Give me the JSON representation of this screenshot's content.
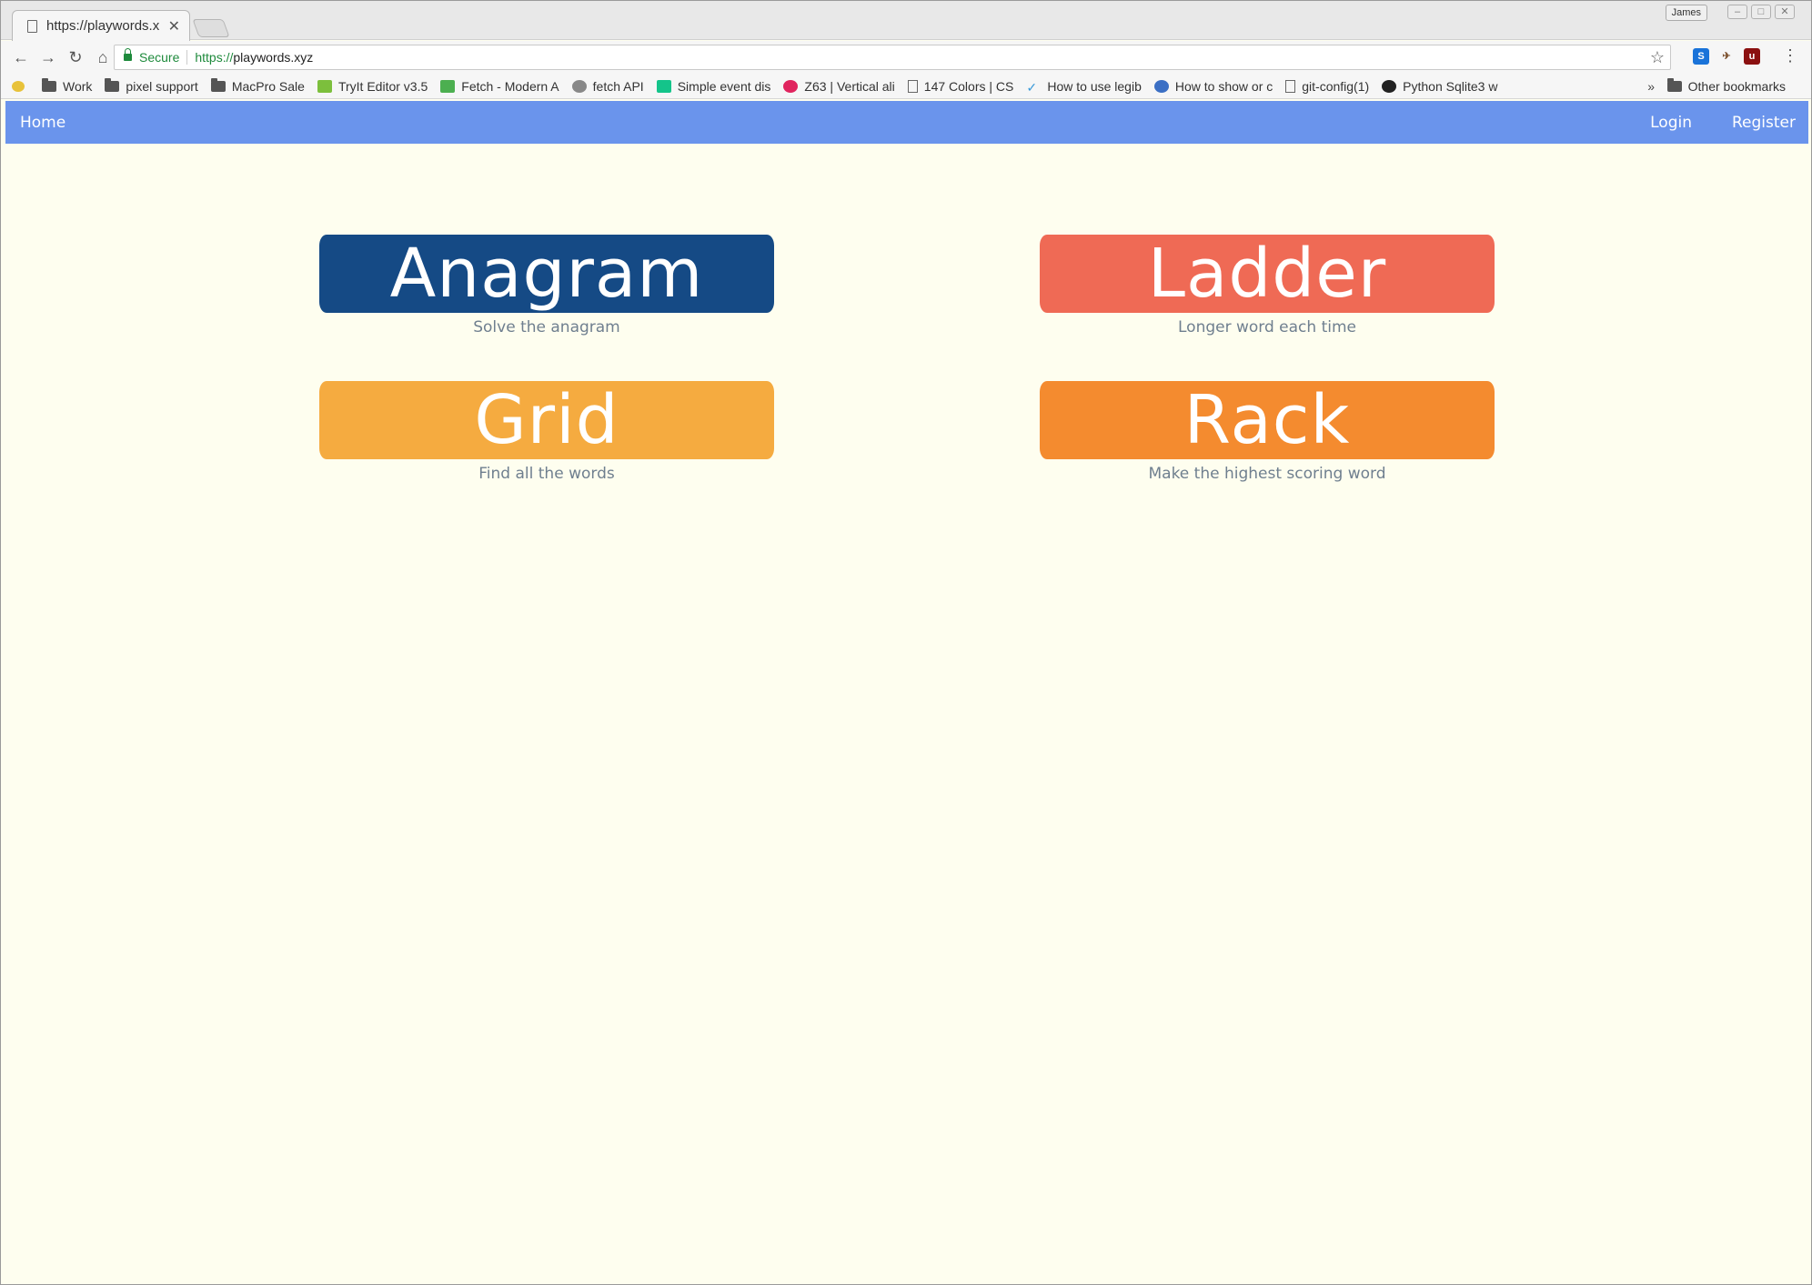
{
  "browser": {
    "tab_title": "https://playwords.x",
    "profile_name": "James",
    "security_label": "Secure",
    "url_scheme": "https://",
    "url_host": "playwords.xyz",
    "bookmarks": [
      "Work",
      "pixel support",
      "MacPro Sale",
      "TryIt Editor v3.5",
      "Fetch - Modern A",
      "fetch API",
      "Simple event dis",
      "Z63 | Vertical ali",
      "147 Colors | CS",
      "How to use legib",
      "How to show or c",
      "git-config(1)",
      "Python Sqlite3 w"
    ],
    "overflow_label": "»",
    "other_bookmarks": "Other bookmarks"
  },
  "navbar": {
    "home": "Home",
    "login": "Login",
    "register": "Register"
  },
  "games": [
    {
      "title": "Anagram",
      "description": "Solve the anagram",
      "color": "#154a85"
    },
    {
      "title": "Ladder",
      "description": "Longer word each time",
      "color": "#ef6a55"
    },
    {
      "title": "Grid",
      "description": "Find all the words",
      "color": "#f5ab40"
    },
    {
      "title": "Rack",
      "description": "Make the highest scoring word",
      "color": "#f48b2f"
    }
  ],
  "colors": {
    "navbar": "#6a94ec",
    "page_background": "#fefeef",
    "description_text": "#6f7f8f"
  }
}
